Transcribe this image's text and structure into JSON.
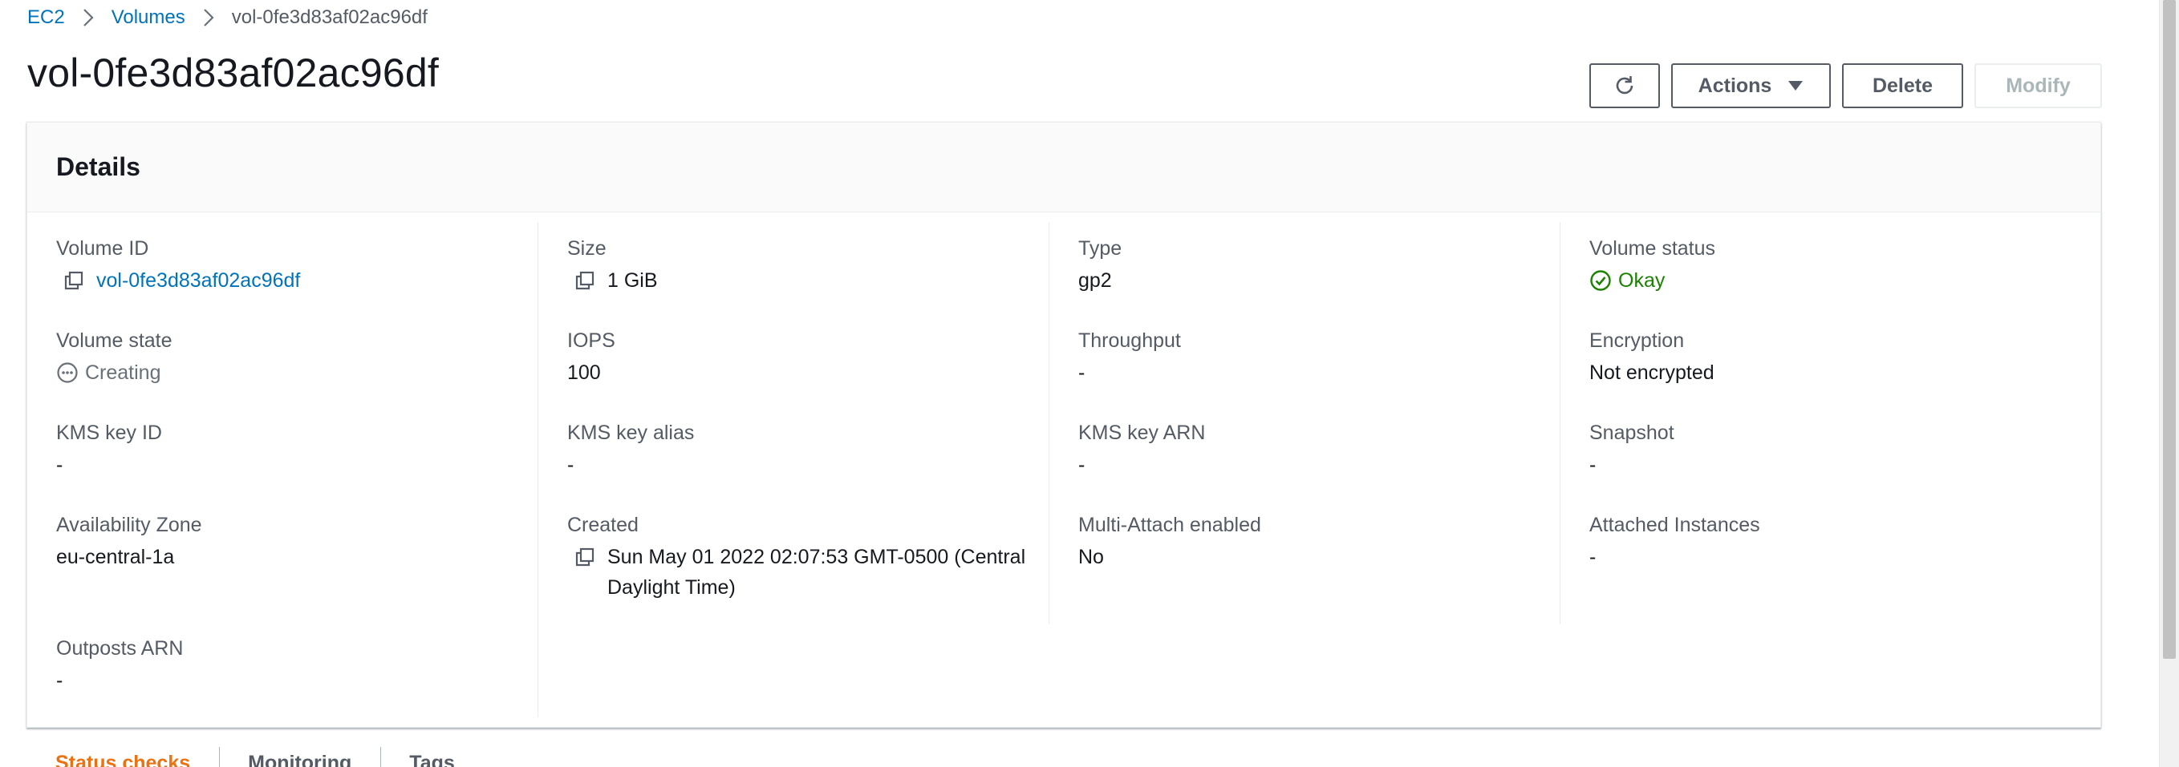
{
  "breadcrumb": {
    "items": [
      "EC2",
      "Volumes"
    ],
    "current": "vol-0fe3d83af02ac96df"
  },
  "header": {
    "title": "vol-0fe3d83af02ac96df",
    "buttons": {
      "actions": "Actions",
      "delete": "Delete",
      "modify": "Modify"
    }
  },
  "details": {
    "title": "Details",
    "volume_id": {
      "label": "Volume ID",
      "value": "vol-0fe3d83af02ac96df"
    },
    "size": {
      "label": "Size",
      "value": "1 GiB"
    },
    "type": {
      "label": "Type",
      "value": "gp2"
    },
    "volume_status": {
      "label": "Volume status",
      "value": "Okay"
    },
    "volume_state": {
      "label": "Volume state",
      "value": "Creating"
    },
    "iops": {
      "label": "IOPS",
      "value": "100"
    },
    "throughput": {
      "label": "Throughput",
      "value": "-"
    },
    "encryption": {
      "label": "Encryption",
      "value": "Not encrypted"
    },
    "kms_key_id": {
      "label": "KMS key ID",
      "value": "-"
    },
    "kms_key_alias": {
      "label": "KMS key alias",
      "value": "-"
    },
    "kms_key_arn": {
      "label": "KMS key ARN",
      "value": "-"
    },
    "snapshot": {
      "label": "Snapshot",
      "value": "-"
    },
    "availability_zone": {
      "label": "Availability Zone",
      "value": "eu-central-1a"
    },
    "created": {
      "label": "Created",
      "value": "Sun May 01 2022 02:07:53 GMT-0500 (Central Daylight Time)"
    },
    "multi_attach": {
      "label": "Multi-Attach enabled",
      "value": "No"
    },
    "attached_instances": {
      "label": "Attached Instances",
      "value": "-"
    },
    "outposts_arn": {
      "label": "Outposts ARN",
      "value": "-"
    }
  },
  "tabs": [
    {
      "label": "Status checks",
      "active": true
    },
    {
      "label": "Monitoring",
      "active": false
    },
    {
      "label": "Tags",
      "active": false
    }
  ],
  "colors": {
    "link": "#0073bb",
    "ok": "#1d8102",
    "active_tab": "#ec7211",
    "pending": "#687078"
  },
  "icons": {
    "refresh": "refresh-icon",
    "dropdown": "caret-down-icon",
    "copy": "copy-icon",
    "status_ok": "check-circle-icon",
    "status_pending": "ellipsis-circle-icon",
    "breadcrumb_separator": "chevron-right-icon"
  }
}
